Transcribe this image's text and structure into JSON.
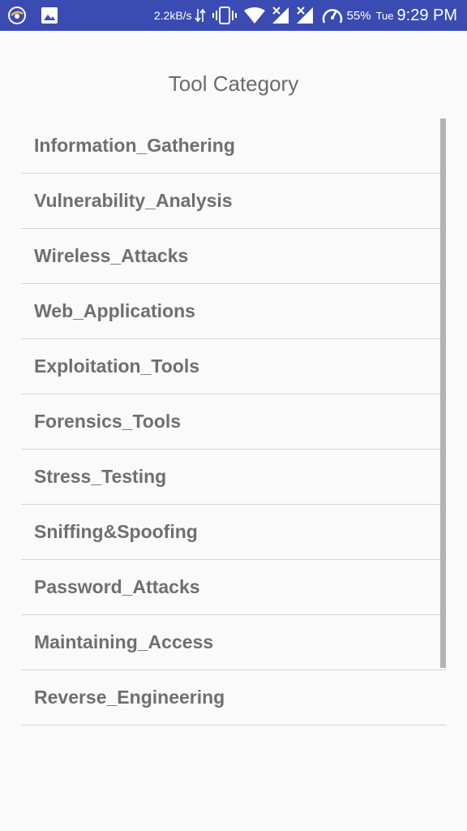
{
  "status_bar": {
    "network_speed": "2.2kB/s",
    "battery_percent": "55%",
    "day": "Tue",
    "time": "9:29 PM",
    "background_color": "#3a4bb3",
    "icons": [
      "app-notification-icon",
      "image-notification-icon",
      "data-transfer-arrows-icon",
      "vibrate-icon",
      "wifi-icon",
      "signal-no-service-icon",
      "signal-no-service-icon-2",
      "battery-gauge-icon"
    ]
  },
  "page": {
    "title": "Tool Category"
  },
  "categories": [
    "Information_Gathering",
    "Vulnerability_Analysis",
    "Wireless_Attacks",
    "Web_Applications",
    "Exploitation_Tools",
    "Forensics_Tools",
    "Stress_Testing",
    "Sniffing&Spoofing",
    "Password_Attacks",
    "Maintaining_Access",
    "Reverse_Engineering"
  ],
  "colors": {
    "background": "#fafafa",
    "item_text": "#6f6f6f",
    "divider": "#d6d6d6",
    "title_text": "#6b6b6b",
    "scrollbar": "#b3b3b3"
  }
}
